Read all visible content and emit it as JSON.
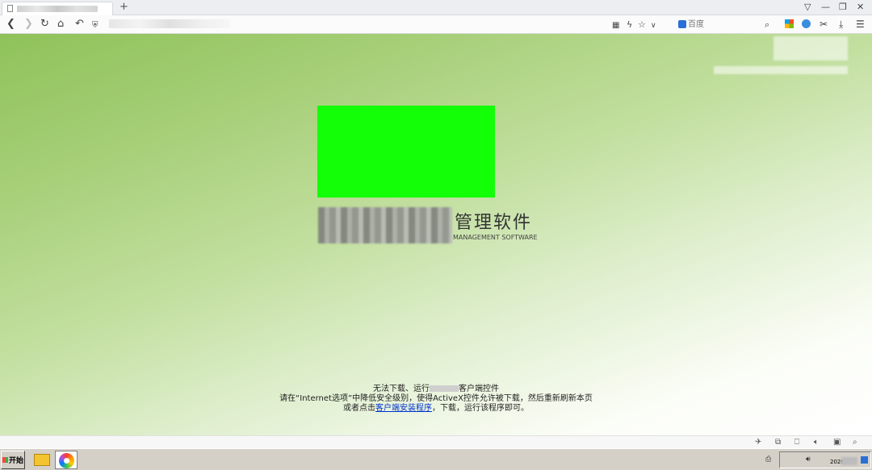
{
  "browser": {
    "new_tab_symbol": "+",
    "window_controls": [
      "▽",
      "—",
      "❐",
      "✕"
    ],
    "search": {
      "engine_label": "百度",
      "placeholder": "百度"
    }
  },
  "page": {
    "product_name": "管理软件",
    "product_subtitle": "MANAGEMENT SOFTWARE",
    "message": {
      "line1_prefix": "无法下载、运行",
      "line1_suffix": "客户端控件",
      "line2": "请在“Internet选项”中降低安全级别，使得ActiveX控件允许被下载，然后重新刷新本页",
      "line3_prefix": "或者点击",
      "line3_link": "客户端安装程序",
      "line3_suffix": "，下载，运行该程序即可。"
    },
    "colors": {
      "brand_box": "#12ff08",
      "gradient_top": "#8fc25a",
      "link": "#0033cc"
    }
  },
  "taskbar": {
    "start_label": "开始",
    "clock_text": "2020"
  }
}
